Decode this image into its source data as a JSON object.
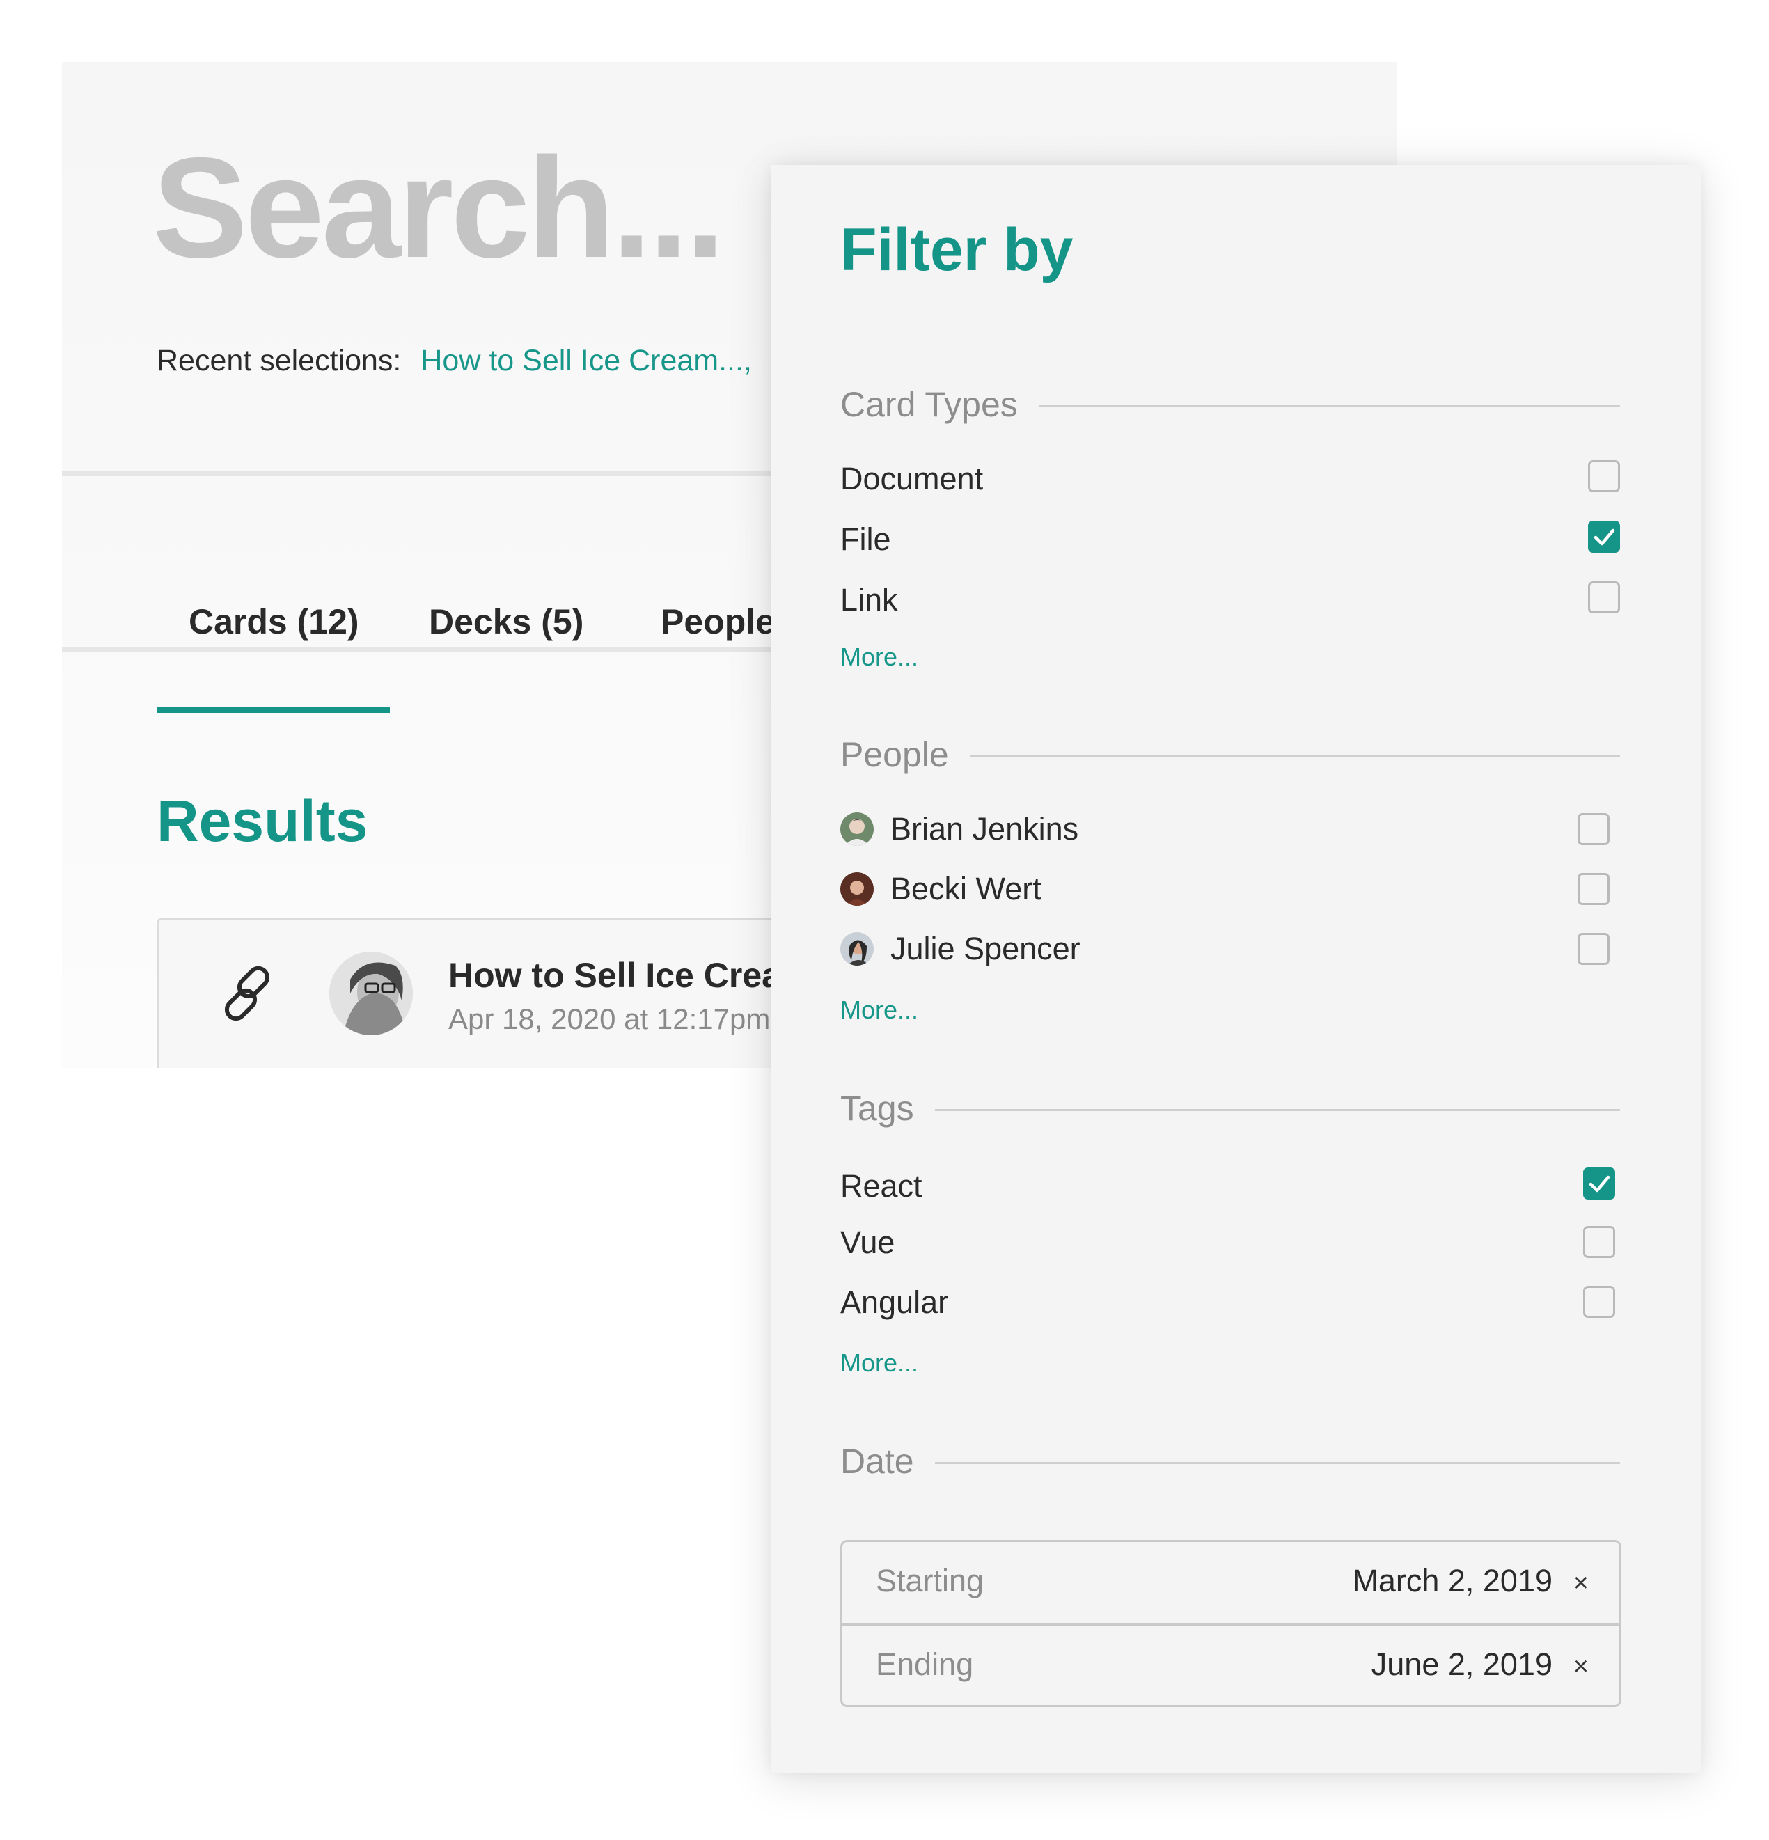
{
  "search": {
    "title": "Search...",
    "recent_label": "Recent selections:",
    "recent_link": "How to Sell Ice Cream...,"
  },
  "tabs": [
    {
      "label": "Cards (12)",
      "active": true
    },
    {
      "label": "Decks (5)",
      "active": false
    },
    {
      "label": "People",
      "active": false
    }
  ],
  "results": {
    "heading": "Results",
    "items": [
      {
        "icon": "link-icon",
        "title": "How to Sell Ice Cream",
        "date": "Apr 18, 2020 at 12:17pm"
      }
    ]
  },
  "filter": {
    "title": "Filter by",
    "card_types": {
      "label": "Card Types",
      "options": [
        {
          "label": "Document",
          "checked": false
        },
        {
          "label": "File",
          "checked": true
        },
        {
          "label": "Link",
          "checked": false
        }
      ],
      "more": "More..."
    },
    "people": {
      "label": "People",
      "options": [
        {
          "label": "Brian Jenkins",
          "checked": false
        },
        {
          "label": "Becki Wert",
          "checked": false
        },
        {
          "label": "Julie Spencer",
          "checked": false
        }
      ],
      "more": "More..."
    },
    "tags": {
      "label": "Tags",
      "options": [
        {
          "label": "React",
          "checked": true
        },
        {
          "label": "Vue",
          "checked": false
        },
        {
          "label": "Angular",
          "checked": false
        }
      ],
      "more": "More..."
    },
    "date": {
      "label": "Date",
      "starting_label": "Starting",
      "starting_value": "March 2, 2019",
      "ending_label": "Ending",
      "ending_value": "June 2, 2019",
      "clear_glyph": "×"
    }
  },
  "colors": {
    "accent": "#159488",
    "muted_text": "#8d8d8d",
    "body_text": "#2a2a2a"
  }
}
